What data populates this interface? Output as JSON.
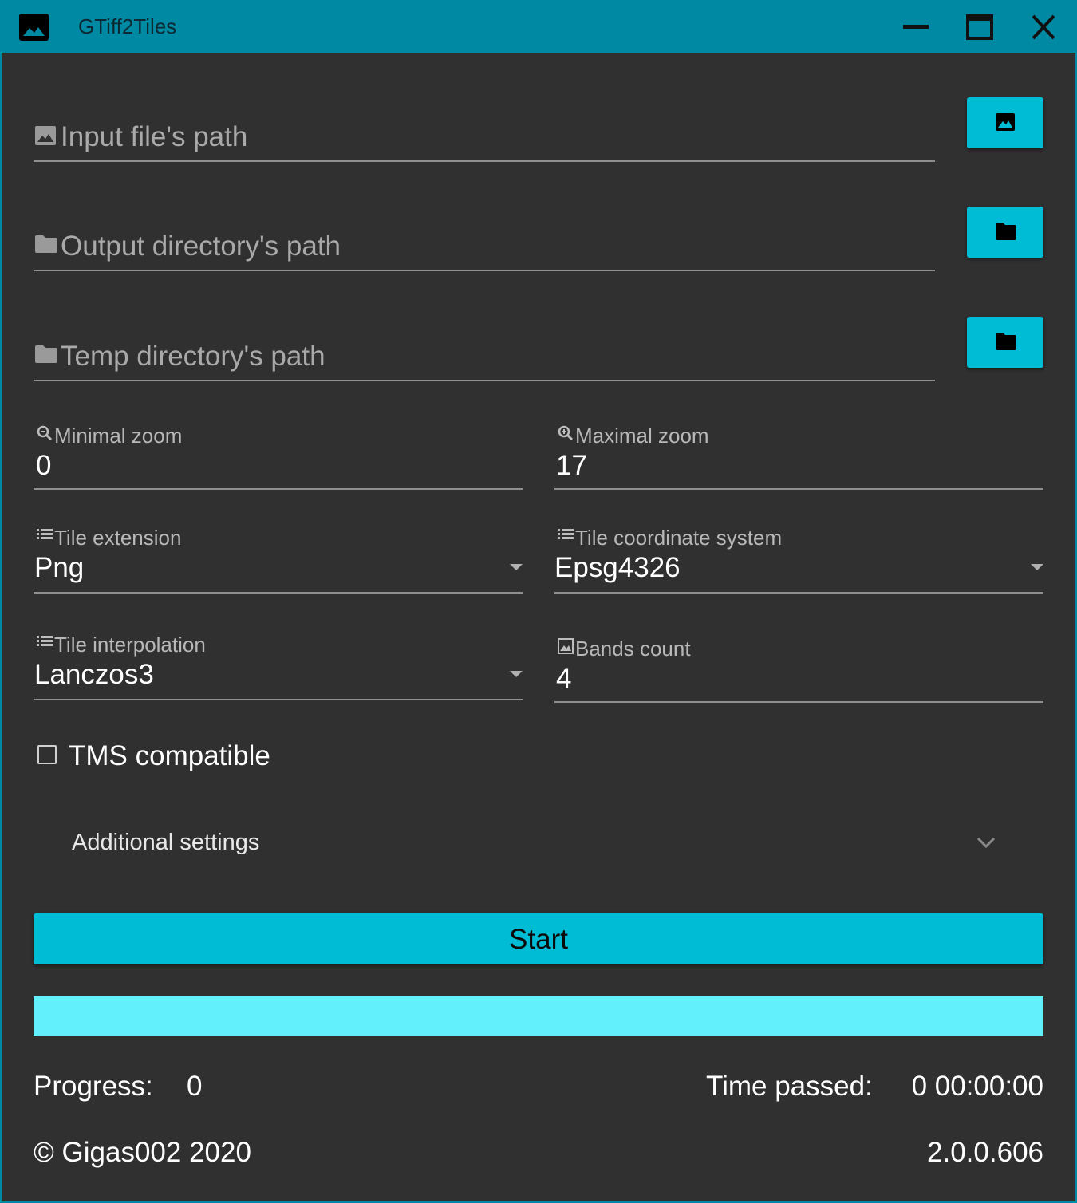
{
  "window": {
    "title": "GTiff2Tiles"
  },
  "paths": {
    "input_file_placeholder": "Input file's path",
    "output_directory_placeholder": "Output directory's path",
    "temp_directory_placeholder": "Temp directory's path"
  },
  "settings": {
    "min_zoom_label": "Minimal zoom",
    "min_zoom_value": "0",
    "max_zoom_label": "Maximal zoom",
    "max_zoom_value": "17",
    "tile_extension_label": "Tile extension",
    "tile_extension_value": "Png",
    "tile_crs_label": "Tile coordinate system",
    "tile_crs_value": "Epsg4326",
    "tile_interpolation_label": "Tile interpolation",
    "tile_interpolation_value": "Lanczos3",
    "bands_count_label": "Bands count",
    "bands_count_value": "4"
  },
  "tms": {
    "label": "TMS compatible",
    "checked": false
  },
  "additional_settings": {
    "label": "Additional settings",
    "expanded": false
  },
  "actions": {
    "start_label": "Start"
  },
  "progress": {
    "fraction": 0,
    "progress_label": "Progress:",
    "progress_value": "0",
    "time_label": "Time passed:",
    "time_value": "0 00:00:00"
  },
  "footer": {
    "copyright": "© Gigas002 2020",
    "version": "2.0.0.606"
  },
  "colors": {
    "accent": "#00bcd4",
    "titlebar": "#0089a3",
    "background": "#303030",
    "progress_track": "#62f0fd"
  },
  "icons": {
    "app": "image-icon",
    "input_button": "image-icon",
    "output_button": "folder-icon",
    "temp_button": "folder-icon"
  }
}
